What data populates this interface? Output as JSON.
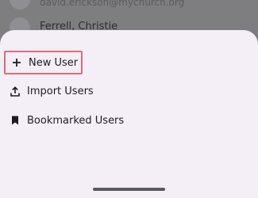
{
  "background": {
    "email": "david.erickson@mychurch.org",
    "name": "Ferrell, Christie"
  },
  "menu": {
    "items": [
      {
        "label": "New User",
        "icon": "plus-icon"
      },
      {
        "label": "Import Users",
        "icon": "upload-icon"
      },
      {
        "label": "Bookmarked Users",
        "icon": "bookmark-icon"
      }
    ]
  },
  "colors": {
    "sheet": "#f4eff6",
    "highlight_border": "#e06a78",
    "text": "#1d1b20",
    "scrim": "#7e7e80"
  }
}
